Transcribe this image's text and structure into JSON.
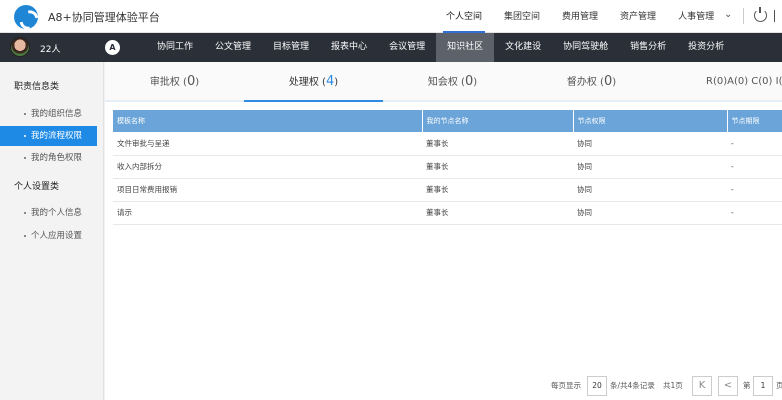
{
  "app": {
    "title": "A8+协同管理体验平台"
  },
  "topnav": [
    "个人空间",
    "集团空间",
    "费用管理",
    "资产管理",
    "人事管理"
  ],
  "user": {
    "name": "22人"
  },
  "mainnav": [
    "协同工作",
    "公文管理",
    "目标管理",
    "报表中心",
    "会议管理",
    "知识社区",
    "文化建设",
    "协同驾驶舱",
    "销售分析",
    "投资分析"
  ],
  "sidebar": {
    "cat1": "职责信息类",
    "items1": [
      "我的组织信息",
      "我的流程权限",
      "我的角色权限"
    ],
    "cat2": "个人设置类",
    "items2": [
      "我的个人信息",
      "个人应用设置"
    ]
  },
  "tabs": [
    {
      "label": "审批权",
      "open": " (",
      "count": "0",
      "close": ")"
    },
    {
      "label": "处理权",
      "open": " (",
      "count": "4",
      "close": ")"
    },
    {
      "label": "知会权",
      "open": " (",
      "count": "0",
      "close": ")"
    },
    {
      "label": "督办权",
      "open": " (",
      "count": "0",
      "close": ")"
    }
  ],
  "tab_last": "R(0)A(0) C(0) I(",
  "table": {
    "headers": [
      "模板名称",
      "我的节点名称",
      "节点权限",
      "节点期限"
    ],
    "rows": [
      [
        "文件审批与呈递",
        "董事长",
        "协同",
        "-"
      ],
      [
        "收入内部拆分",
        "董事长",
        "协同",
        "-"
      ],
      [
        "项目日常费用报销",
        "董事长",
        "协同",
        "-"
      ],
      [
        "请示",
        "董事长",
        "协同",
        "-"
      ]
    ]
  },
  "pager": {
    "per_page_label": "每页显示",
    "per_page": "20",
    "summary": "条/共4条记录",
    "total_pages": "共1页",
    "first": "K",
    "prev": "<",
    "page_label": "第",
    "page": "1",
    "page_suffix": "页"
  }
}
